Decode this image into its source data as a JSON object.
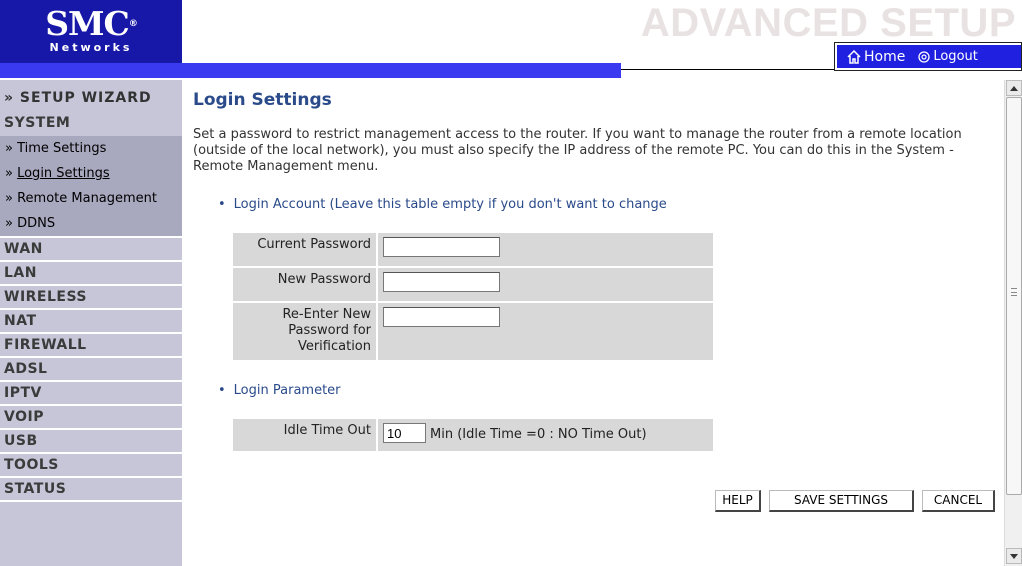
{
  "header": {
    "logo_brand": "SMC",
    "logo_reg": "®",
    "logo_sub": "Networks",
    "title": "ADVANCED SETUP",
    "nav": {
      "home": "Home",
      "logout": "Logout"
    }
  },
  "sidebar": {
    "wizard": "» SETUP WIZARD",
    "system": "SYSTEM",
    "sub_items": [
      {
        "label": "» ",
        "text": "Time Settings"
      },
      {
        "label": "» ",
        "text": "Login Settings"
      },
      {
        "label": "» ",
        "text": "Remote Management"
      },
      {
        "label": "» ",
        "text": "DDNS"
      }
    ],
    "menus": [
      "WAN",
      "LAN",
      "WIRELESS",
      "NAT",
      "FIREWALL",
      "ADSL",
      "IPTV",
      "VOIP",
      "USB",
      "TOOLS",
      "STATUS"
    ]
  },
  "main": {
    "title": "Login Settings",
    "description": "Set a password to restrict management access to the router. If you want to manage the router from a remote location (outside of the local network), you must also specify the IP address of the remote PC. You can do this in the System - Remote Management menu.",
    "section1": "Login Account (Leave this table empty if you don't want to change",
    "current_password_label": "Current Password",
    "new_password_label": "New Password",
    "reenter_label": "Re-Enter New Password for Verification",
    "section2": "Login Parameter",
    "idle_label": "Idle Time Out",
    "idle_value": "10",
    "idle_unit": "Min (Idle Time =0 : NO Time Out)",
    "buttons": {
      "help": "HELP",
      "save": "SAVE SETTINGS",
      "cancel": "CANCEL"
    }
  }
}
